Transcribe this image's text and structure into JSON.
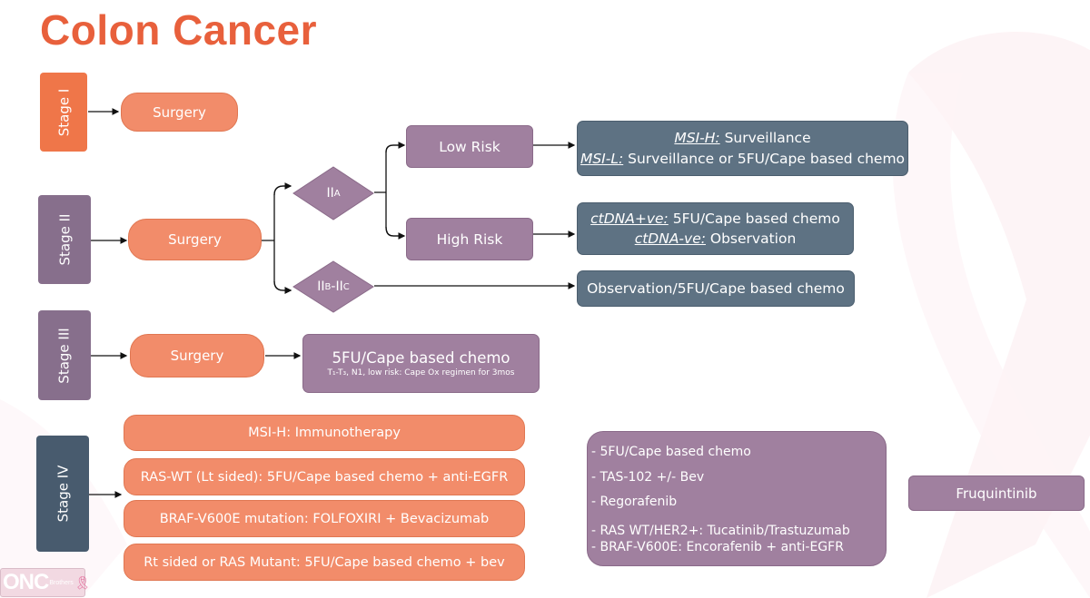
{
  "title": "Colon Cancer",
  "colors": {
    "title": "#e8603c",
    "stage_orange": "#ef7649",
    "stage_purple": "#876f8c",
    "stage_slate": "#485b6e",
    "pill_orange": "#f28c6a",
    "purple_box": "#a0809f",
    "slate_box": "#5e7283"
  },
  "stages": [
    {
      "label": "Stage I"
    },
    {
      "label": "Stage II"
    },
    {
      "label": "Stage III"
    },
    {
      "label": "Stage IV"
    }
  ],
  "stage1": {
    "surgery": "Surgery"
  },
  "stage2": {
    "surgery": "Surgery",
    "iia": {
      "main": "II",
      "sub": "A"
    },
    "iibc": {
      "main1": "II",
      "sub1": "B",
      "sep": "-",
      "main2": "II",
      "sub2": "C"
    },
    "low_risk": "Low Risk",
    "high_risk": "High Risk",
    "low_risk_outcome": [
      {
        "label": "MSI-H:",
        "text": " Surveillance"
      },
      {
        "label": "MSI-L:",
        "text": " Surveillance or 5FU/Cape based chemo"
      }
    ],
    "high_risk_outcome": [
      {
        "label": "ctDNA+ve:",
        "text": " 5FU/Cape based chemo"
      },
      {
        "label": "ctDNA-ve:",
        "text": " Observation"
      }
    ],
    "iibc_outcome": "Observation/5FU/Cape based chemo"
  },
  "stage3": {
    "surgery": "Surgery",
    "chemo": "5FU/Cape based chemo",
    "chemo_note": "T₁-T₃, N1, low risk: Cape Ox regimen for 3mos"
  },
  "stage4": {
    "first_line": [
      "MSI-H: Immunotherapy",
      "RAS-WT (Lt sided): 5FU/Cape based chemo + anti-EGFR",
      "BRAF-V600E mutation: FOLFOXIRI + Bevacizumab",
      "Rt sided or RAS Mutant: 5FU/Cape based chemo + bev"
    ],
    "later_line": [
      "- 5FU/Cape based chemo",
      "- TAS-102 +/- Bev",
      "- Regorafenib",
      "- RAS WT/HER2+: Tucatinib/Trastuzumab",
      "- BRAF-V600E: Encorafenib + anti-EGFR"
    ],
    "final": "Fruquintinib"
  },
  "logo": {
    "main": "ONC",
    "sub": "Brothers",
    "icon": "ribbon-icon"
  }
}
